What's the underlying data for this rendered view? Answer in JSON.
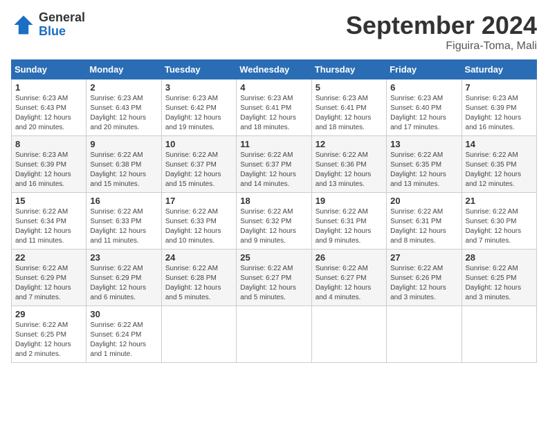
{
  "logo": {
    "general": "General",
    "blue": "Blue"
  },
  "header": {
    "month": "September 2024",
    "location": "Figuira-Toma, Mali"
  },
  "weekdays": [
    "Sunday",
    "Monday",
    "Tuesday",
    "Wednesday",
    "Thursday",
    "Friday",
    "Saturday"
  ],
  "weeks": [
    [
      {
        "day": "1",
        "sunrise": "6:23 AM",
        "sunset": "6:43 PM",
        "daylight": "12 hours and 20 minutes."
      },
      {
        "day": "2",
        "sunrise": "6:23 AM",
        "sunset": "6:43 PM",
        "daylight": "12 hours and 20 minutes."
      },
      {
        "day": "3",
        "sunrise": "6:23 AM",
        "sunset": "6:42 PM",
        "daylight": "12 hours and 19 minutes."
      },
      {
        "day": "4",
        "sunrise": "6:23 AM",
        "sunset": "6:41 PM",
        "daylight": "12 hours and 18 minutes."
      },
      {
        "day": "5",
        "sunrise": "6:23 AM",
        "sunset": "6:41 PM",
        "daylight": "12 hours and 18 minutes."
      },
      {
        "day": "6",
        "sunrise": "6:23 AM",
        "sunset": "6:40 PM",
        "daylight": "12 hours and 17 minutes."
      },
      {
        "day": "7",
        "sunrise": "6:23 AM",
        "sunset": "6:39 PM",
        "daylight": "12 hours and 16 minutes."
      }
    ],
    [
      {
        "day": "8",
        "sunrise": "6:23 AM",
        "sunset": "6:39 PM",
        "daylight": "12 hours and 16 minutes."
      },
      {
        "day": "9",
        "sunrise": "6:22 AM",
        "sunset": "6:38 PM",
        "daylight": "12 hours and 15 minutes."
      },
      {
        "day": "10",
        "sunrise": "6:22 AM",
        "sunset": "6:37 PM",
        "daylight": "12 hours and 15 minutes."
      },
      {
        "day": "11",
        "sunrise": "6:22 AM",
        "sunset": "6:37 PM",
        "daylight": "12 hours and 14 minutes."
      },
      {
        "day": "12",
        "sunrise": "6:22 AM",
        "sunset": "6:36 PM",
        "daylight": "12 hours and 13 minutes."
      },
      {
        "day": "13",
        "sunrise": "6:22 AM",
        "sunset": "6:35 PM",
        "daylight": "12 hours and 13 minutes."
      },
      {
        "day": "14",
        "sunrise": "6:22 AM",
        "sunset": "6:35 PM",
        "daylight": "12 hours and 12 minutes."
      }
    ],
    [
      {
        "day": "15",
        "sunrise": "6:22 AM",
        "sunset": "6:34 PM",
        "daylight": "12 hours and 11 minutes."
      },
      {
        "day": "16",
        "sunrise": "6:22 AM",
        "sunset": "6:33 PM",
        "daylight": "12 hours and 11 minutes."
      },
      {
        "day": "17",
        "sunrise": "6:22 AM",
        "sunset": "6:33 PM",
        "daylight": "12 hours and 10 minutes."
      },
      {
        "day": "18",
        "sunrise": "6:22 AM",
        "sunset": "6:32 PM",
        "daylight": "12 hours and 9 minutes."
      },
      {
        "day": "19",
        "sunrise": "6:22 AM",
        "sunset": "6:31 PM",
        "daylight": "12 hours and 9 minutes."
      },
      {
        "day": "20",
        "sunrise": "6:22 AM",
        "sunset": "6:31 PM",
        "daylight": "12 hours and 8 minutes."
      },
      {
        "day": "21",
        "sunrise": "6:22 AM",
        "sunset": "6:30 PM",
        "daylight": "12 hours and 7 minutes."
      }
    ],
    [
      {
        "day": "22",
        "sunrise": "6:22 AM",
        "sunset": "6:29 PM",
        "daylight": "12 hours and 7 minutes."
      },
      {
        "day": "23",
        "sunrise": "6:22 AM",
        "sunset": "6:29 PM",
        "daylight": "12 hours and 6 minutes."
      },
      {
        "day": "24",
        "sunrise": "6:22 AM",
        "sunset": "6:28 PM",
        "daylight": "12 hours and 5 minutes."
      },
      {
        "day": "25",
        "sunrise": "6:22 AM",
        "sunset": "6:27 PM",
        "daylight": "12 hours and 5 minutes."
      },
      {
        "day": "26",
        "sunrise": "6:22 AM",
        "sunset": "6:27 PM",
        "daylight": "12 hours and 4 minutes."
      },
      {
        "day": "27",
        "sunrise": "6:22 AM",
        "sunset": "6:26 PM",
        "daylight": "12 hours and 3 minutes."
      },
      {
        "day": "28",
        "sunrise": "6:22 AM",
        "sunset": "6:25 PM",
        "daylight": "12 hours and 3 minutes."
      }
    ],
    [
      {
        "day": "29",
        "sunrise": "6:22 AM",
        "sunset": "6:25 PM",
        "daylight": "12 hours and 2 minutes."
      },
      {
        "day": "30",
        "sunrise": "6:22 AM",
        "sunset": "6:24 PM",
        "daylight": "12 hours and 1 minute."
      },
      null,
      null,
      null,
      null,
      null
    ]
  ]
}
